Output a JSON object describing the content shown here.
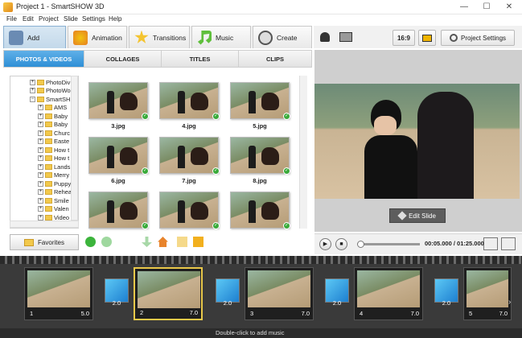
{
  "window": {
    "title": "Project 1 - SmartSHOW 3D",
    "controls": {
      "minimize": "—",
      "maximize": "☐",
      "close": "✕"
    }
  },
  "menu": [
    "File",
    "Edit",
    "Project",
    "Slide",
    "Settings",
    "Help"
  ],
  "main_tabs": [
    {
      "label": "Add",
      "active": true
    },
    {
      "label": "Animation"
    },
    {
      "label": "Transitions"
    },
    {
      "label": "Music"
    },
    {
      "label": "Create"
    }
  ],
  "right_tools": {
    "ratio": "16:9",
    "project_settings": "Project Settings"
  },
  "sub_tabs": [
    "PHOTOS & VIDEOS",
    "COLLAGES",
    "TITLES",
    "CLIPS"
  ],
  "tree": [
    "PhotoDiv",
    "PhotoWo",
    "SmartSH",
    "AMS",
    "Baby",
    "Baby",
    "Churc",
    "Easte",
    "How t",
    "How t",
    "Lands",
    "Merry",
    "Puppy",
    "Rehea",
    "Smile",
    "Valen",
    "Video"
  ],
  "thumbnails": [
    "3.jpg",
    "4.jpg",
    "5.jpg",
    "6.jpg",
    "7.jpg",
    "8.jpg",
    "",
    "",
    ""
  ],
  "favorites_label": "Favorites",
  "preview": {
    "edit_slide": "Edit Slide",
    "time": "00:05.000 / 01:25.000"
  },
  "timeline": {
    "slides": [
      {
        "num": "1",
        "dur": "5.0"
      },
      {
        "num": "2",
        "dur": "7.0"
      },
      {
        "num": "3",
        "dur": "7.0"
      },
      {
        "num": "4",
        "dur": "7.0"
      },
      {
        "num": "5",
        "dur": "7.0"
      }
    ],
    "transitions": [
      "2.0",
      "2.0",
      "2.0",
      "2.0"
    ],
    "music_hint": "Double-click to add music"
  },
  "colors": {
    "accent_tab": "#2f8fd6",
    "selected_slide": "#e9c84a"
  }
}
